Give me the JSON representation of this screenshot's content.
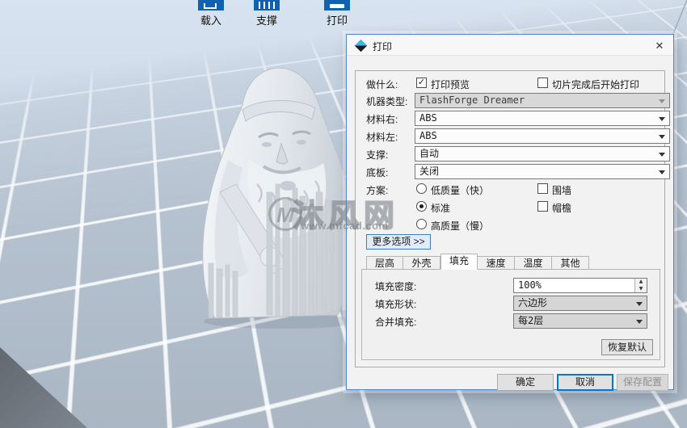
{
  "colors": {
    "toolbar_icon_blue": "#1062ae",
    "dialog_border_blue": "#4a86c8",
    "default_button_border": "#0078d7",
    "viewport_sky": "#d8e3f0",
    "grid_line": "#ffffff"
  },
  "toolbar": {
    "items": [
      {
        "icon": "load-icon",
        "label": "载入"
      },
      {
        "icon": "support-icon",
        "label": "支撑"
      },
      {
        "icon": "print-icon",
        "label": "打印"
      }
    ]
  },
  "viewport": {
    "model": "3d-figurine-with-supports"
  },
  "watermark": {
    "logo_text": "M",
    "site_name": "沐风网",
    "site_url": "www.mfcad.com"
  },
  "dialog": {
    "title": "打印",
    "what_row": {
      "label": "做什么:",
      "preview": {
        "label": "打印预览",
        "checked": true
      },
      "after_slice": {
        "label": "切片完成后开始打印",
        "checked": false
      }
    },
    "fields": [
      {
        "label": "机器类型:",
        "value": "FlashForge Dreamer",
        "disabled": true
      },
      {
        "label": "材料右:",
        "value": "ABS",
        "disabled": false
      },
      {
        "label": "材料左:",
        "value": "ABS",
        "disabled": false
      },
      {
        "label": "支撑:",
        "value": "自动",
        "disabled": false
      },
      {
        "label": "底板:",
        "value": "关闭",
        "disabled": false
      }
    ],
    "scheme": {
      "label": "方案:",
      "radios": [
        {
          "label": "低质量（快）",
          "selected": false
        },
        {
          "label": "标准",
          "selected": true
        },
        {
          "label": "高质量（慢）",
          "selected": false
        }
      ],
      "checks": [
        {
          "label": "围墙",
          "checked": false
        },
        {
          "label": "帽檐",
          "checked": false
        }
      ]
    },
    "more_options_label": "更多选项 >>",
    "tabs": {
      "items": [
        {
          "label": "层高"
        },
        {
          "label": "外壳"
        },
        {
          "label": "填充"
        },
        {
          "label": "速度"
        },
        {
          "label": "温度"
        },
        {
          "label": "其他"
        }
      ],
      "active": "填充"
    },
    "infill": {
      "rows": [
        {
          "label": "填充密度:",
          "value": "100%"
        },
        {
          "label": "填充形状:",
          "value": "六边形"
        },
        {
          "label": "合并填充:",
          "value": "每2层"
        }
      ],
      "restore_label": "恢复默认"
    },
    "footer": {
      "ok": "确定",
      "cancel": "取消",
      "save": "保存配置"
    }
  },
  "icons": {
    "check": "✓",
    "close": "✕",
    "spin_up": "▲",
    "spin_down": "▼"
  }
}
